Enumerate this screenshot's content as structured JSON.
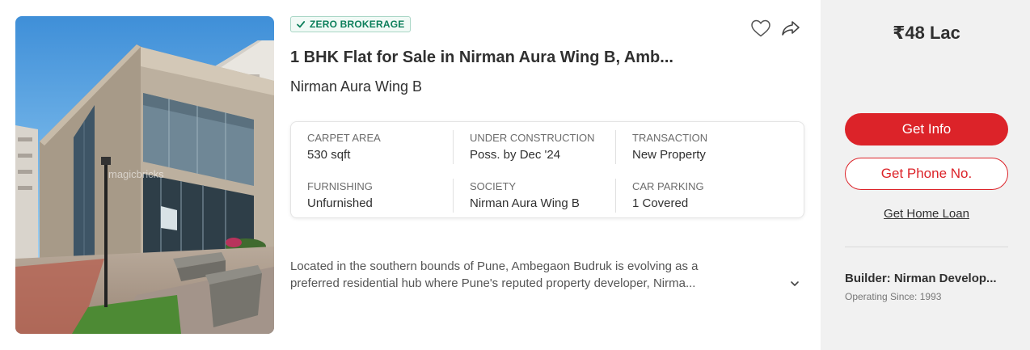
{
  "listing": {
    "badge": "ZERO BROKERAGE",
    "title": "1 BHK Flat for Sale in Nirman Aura Wing B, Amb...",
    "project": "Nirman Aura Wing B",
    "photo_watermark": "magicbricks",
    "specs": [
      {
        "label": "CARPET AREA",
        "value": "530 sqft"
      },
      {
        "label": "UNDER CONSTRUCTION",
        "value": "Poss. by Dec '24"
      },
      {
        "label": "TRANSACTION",
        "value": "New Property"
      },
      {
        "label": "FURNISHING",
        "value": "Unfurnished"
      },
      {
        "label": "SOCIETY",
        "value": "Nirman Aura Wing B"
      },
      {
        "label": "CAR PARKING",
        "value": "1 Covered"
      }
    ],
    "description_line1": "Located in the southern bounds of Pune, Ambegaon Budruk is evolving as a",
    "description_line2": "preferred residential hub where Pune's reputed property developer, Nirma..."
  },
  "sidebar": {
    "price": "₹48 Lac",
    "get_info": "Get Info",
    "get_phone": "Get Phone No.",
    "home_loan": "Get Home Loan",
    "builder": "Builder: Nirman Develop...",
    "operating_since": "Operating Since: 1993"
  },
  "icons": {
    "badge": "check-icon",
    "heart": "heart-icon",
    "share": "share-icon",
    "expand": "chevron-down-icon"
  },
  "colors": {
    "accent_red": "#dc2329",
    "badge_green": "#0d7f5b",
    "panel_gray": "#f1f1f1"
  }
}
